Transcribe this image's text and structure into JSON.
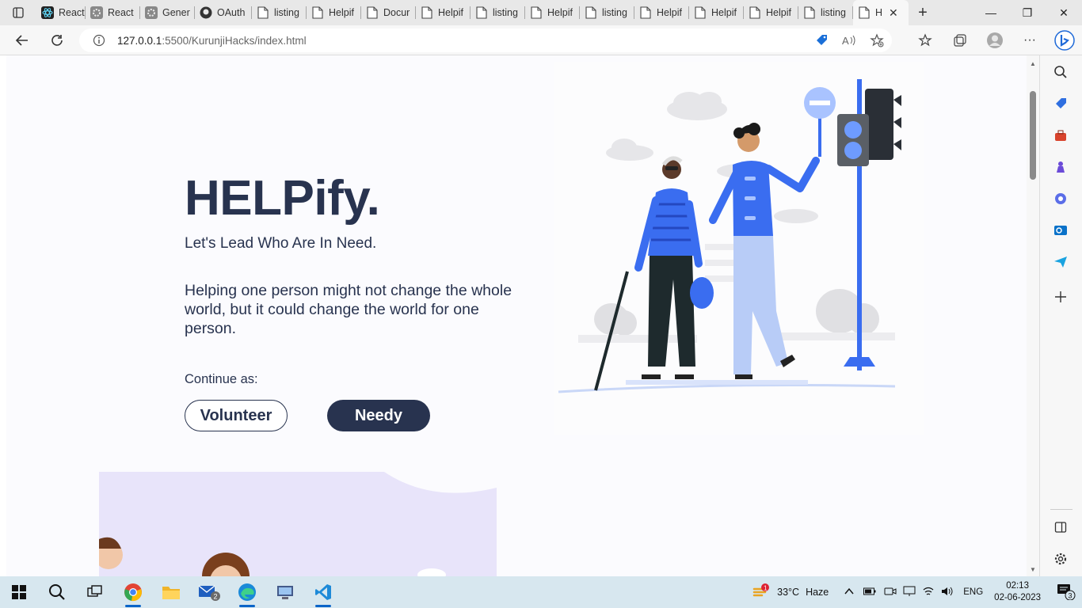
{
  "browser": {
    "tabs": [
      {
        "label": "React",
        "icon": "react-icon"
      },
      {
        "label": "React",
        "icon": "gear-icon"
      },
      {
        "label": "Gener",
        "icon": "gear-icon"
      },
      {
        "label": "OAuth",
        "icon": "github-icon"
      },
      {
        "label": "listing",
        "icon": "page-icon"
      },
      {
        "label": "Helpif",
        "icon": "page-icon"
      },
      {
        "label": "Docur",
        "icon": "page-icon"
      },
      {
        "label": "Helpif",
        "icon": "page-icon"
      },
      {
        "label": "listing",
        "icon": "page-icon"
      },
      {
        "label": "Helpif",
        "icon": "page-icon"
      },
      {
        "label": "listing",
        "icon": "page-icon"
      },
      {
        "label": "Helpif",
        "icon": "page-icon"
      },
      {
        "label": "Helpif",
        "icon": "page-icon"
      },
      {
        "label": "Helpif",
        "icon": "page-icon"
      },
      {
        "label": "listing",
        "icon": "page-icon"
      },
      {
        "label": "H",
        "icon": "page-icon",
        "active": true
      }
    ],
    "url_host": "127.0.0.1",
    "url_path": ":5500/KurunjiHacks/index.html"
  },
  "page": {
    "title": "HELPify.",
    "tagline": "Let's Lead Who Are In Need.",
    "quote": "Helping one person might not change the whole world, but it could change the world for one person.",
    "continue_label": "Continue as:",
    "volunteer_label": "Volunteer",
    "needy_label": "Needy"
  },
  "colors": {
    "brand": "#28334f",
    "illustration_blue": "#3a6df0",
    "edge_blue": "#0a64c8"
  },
  "taskbar": {
    "mail_badge": "2",
    "weather_badge": "1",
    "temperature": "33°C",
    "weather": "Haze",
    "lang": "ENG",
    "time": "02:13",
    "date": "02-06-2023",
    "notif_count": "3"
  }
}
